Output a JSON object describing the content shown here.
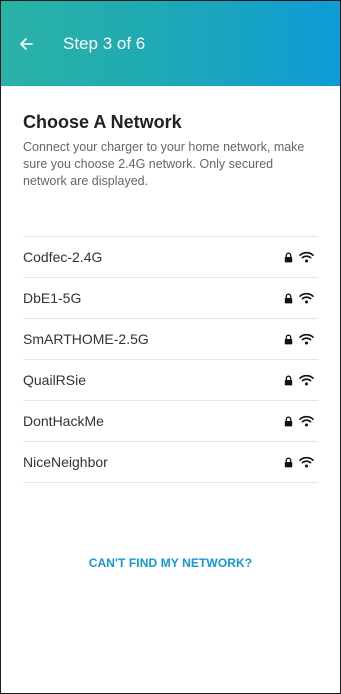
{
  "header": {
    "back_icon": "arrow-left-icon",
    "title": "Step 3 of 6",
    "gradient_colors": [
      "#2bb2a6",
      "#0f9bd6"
    ]
  },
  "main": {
    "title": "Choose A Network",
    "description": "Connect your charger to your home network, make sure you choose 2.4G network. Only secured network are displayed."
  },
  "networks": [
    {
      "name": "Codfec-2.4G",
      "icons": [
        "lock-icon",
        "wifi-icon"
      ]
    },
    {
      "name": "DbE1-5G",
      "icons": [
        "lock-icon",
        "wifi-icon"
      ]
    },
    {
      "name": "SmARTHOME-2.5G",
      "icons": [
        "lock-icon",
        "wifi-icon"
      ]
    },
    {
      "name": "QuailRSie",
      "icons": [
        "lock-icon",
        "wifi-icon"
      ]
    },
    {
      "name": "DontHackMe",
      "icons": [
        "lock-icon",
        "wifi-icon"
      ]
    },
    {
      "name": "NiceNeighbor",
      "icons": [
        "lock-icon",
        "wifi-icon"
      ]
    }
  ],
  "footer": {
    "cant_find_label": "CAN'T FIND MY NETWORK?",
    "link_color": "#1199d6"
  }
}
